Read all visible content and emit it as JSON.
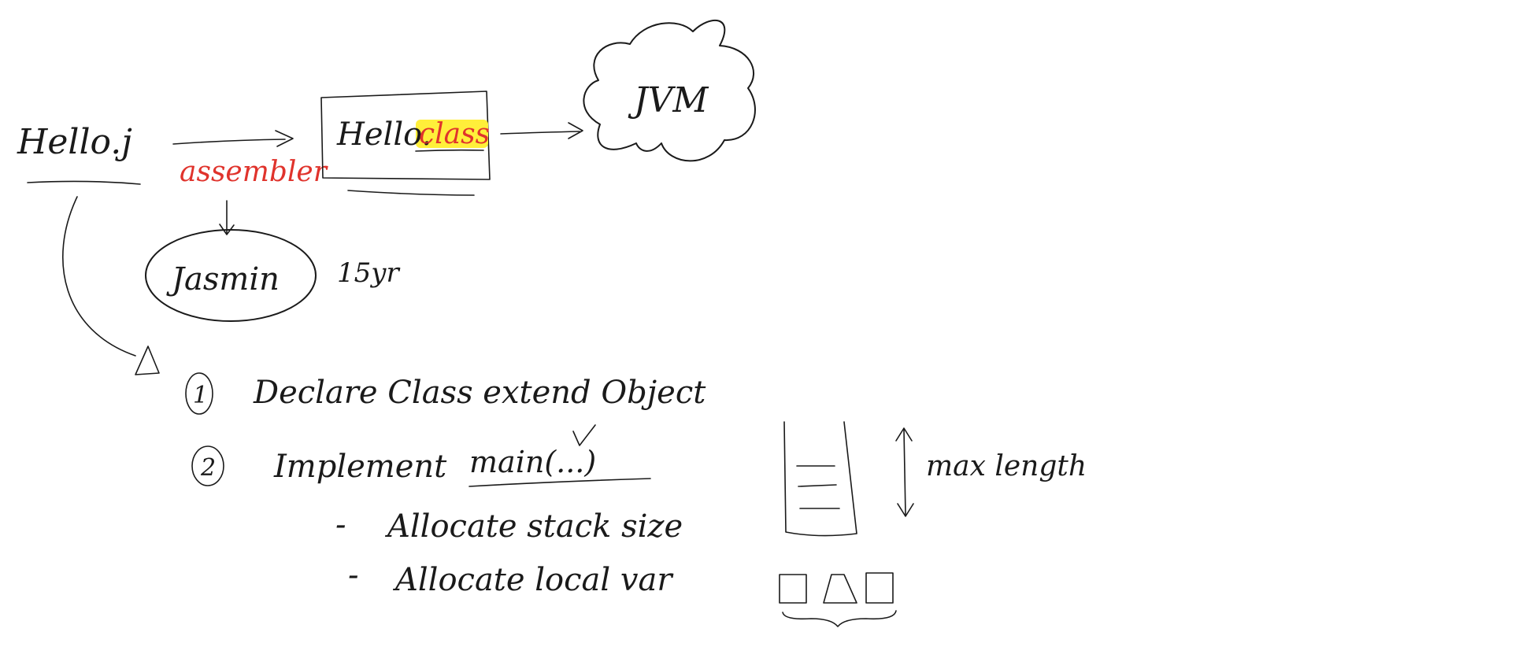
{
  "labels": {
    "source_file": "Hello.j",
    "class_file": "Hello.",
    "class_ext": "class",
    "vm": "JVM",
    "assembler": "assembler",
    "jasmin": "Jasmin",
    "age": "15yr"
  },
  "steps": {
    "step1_num": "1",
    "step1_text": "Declare Class extend Object",
    "step2_num": "2",
    "step2_text": "Implement",
    "step2_main": "main(...)",
    "sub1_dash": "-",
    "sub1_text": "Allocate stack size",
    "sub2_dash": "-",
    "sub2_text": "Allocate local var"
  },
  "stack": {
    "label": "max length"
  },
  "colors": {
    "ink": "#1a1a1a",
    "red": "#e0332c",
    "highlight": "#ffef3a"
  }
}
